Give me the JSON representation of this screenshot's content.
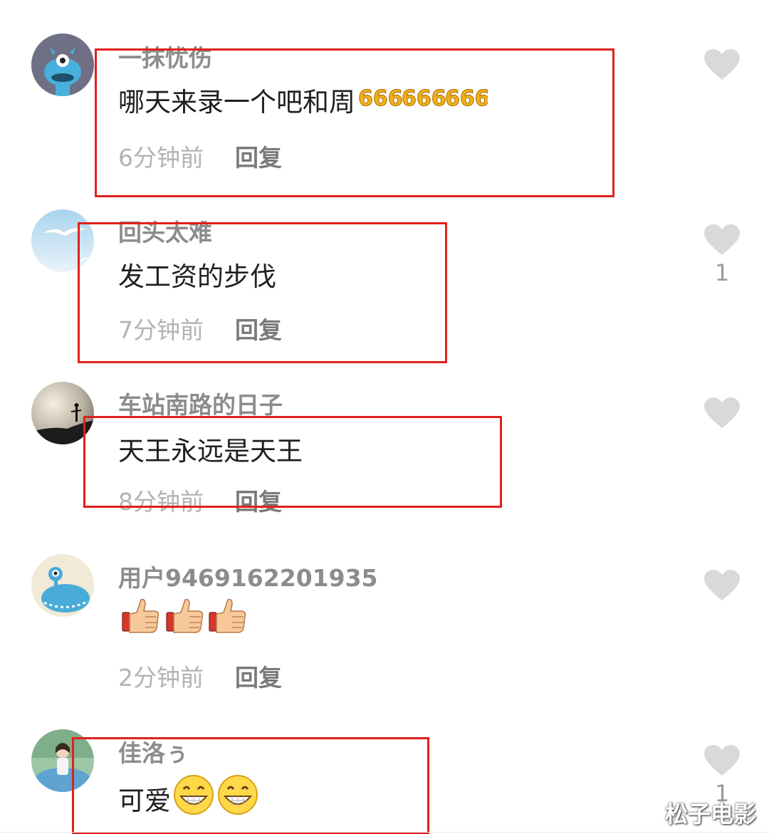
{
  "comments": [
    {
      "username": "一抹忧伤",
      "content": "哪天来录一个吧和周",
      "emoji_icon": "666-icon",
      "time": "6分钟前",
      "reply_label": "回复",
      "likes": ""
    },
    {
      "username": "回头太难",
      "content": "发工资的步伐",
      "time": "7分钟前",
      "reply_label": "回复",
      "likes": "1"
    },
    {
      "username": "车站南路的日子",
      "content": "天王永远是天王",
      "time": "8分钟前",
      "reply_label": "回复",
      "likes": ""
    },
    {
      "username": "用户9469162201935",
      "content": "",
      "emoji_icon": "thumbs-up-icon",
      "time": "2分钟前",
      "reply_label": "回复",
      "likes": ""
    },
    {
      "username": "佳洛ぅ",
      "content": "可爱",
      "emoji_icon": "grinning-face-icon",
      "time": "",
      "reply_label": "",
      "likes": "1"
    }
  ],
  "watermark": "松子电影",
  "colors": {
    "highlight_box": "#e0201c",
    "heart": "#d9d9d9",
    "username": "#8c8c8c"
  }
}
